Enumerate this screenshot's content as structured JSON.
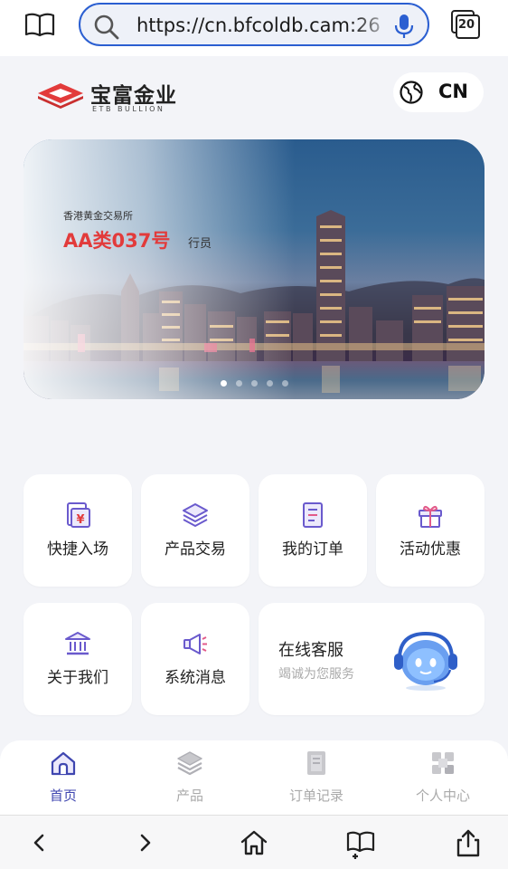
{
  "browser": {
    "url": "https://cn.bfcoldb.cam:26",
    "tab_count": "20"
  },
  "header": {
    "logo_cn": "宝富金业",
    "logo_en": "ETB BULLION",
    "lang": "CN"
  },
  "banner": {
    "sub_text": "香港黄金交易所",
    "main_text": "AA类037号",
    "tail_text": "行员",
    "slide_count": 5,
    "active_slide": 1
  },
  "tiles": [
    {
      "label": "快捷入场",
      "icon": "yuan-document-icon"
    },
    {
      "label": "产品交易",
      "icon": "layers-icon"
    },
    {
      "label": "我的订单",
      "icon": "order-list-icon"
    },
    {
      "label": "活动优惠",
      "icon": "gift-icon"
    },
    {
      "label": "关于我们",
      "icon": "bank-icon"
    },
    {
      "label": "系统消息",
      "icon": "megaphone-icon"
    }
  ],
  "service": {
    "title": "在线客服",
    "subtitle": "竭诚为您服务",
    "mascot": "headset-robot-mascot"
  },
  "nav": [
    {
      "label": "首页",
      "icon": "home-icon",
      "active": true
    },
    {
      "label": "产品",
      "icon": "layers-icon",
      "active": false
    },
    {
      "label": "订单记录",
      "icon": "records-icon",
      "active": false
    },
    {
      "label": "个人中心",
      "icon": "profile-icon",
      "active": false
    }
  ],
  "colors": {
    "accent": "#3f46b0",
    "brand_red": "#e23b3b",
    "url_border": "#2b5fd1",
    "icon_purple": "#6a5acd"
  }
}
